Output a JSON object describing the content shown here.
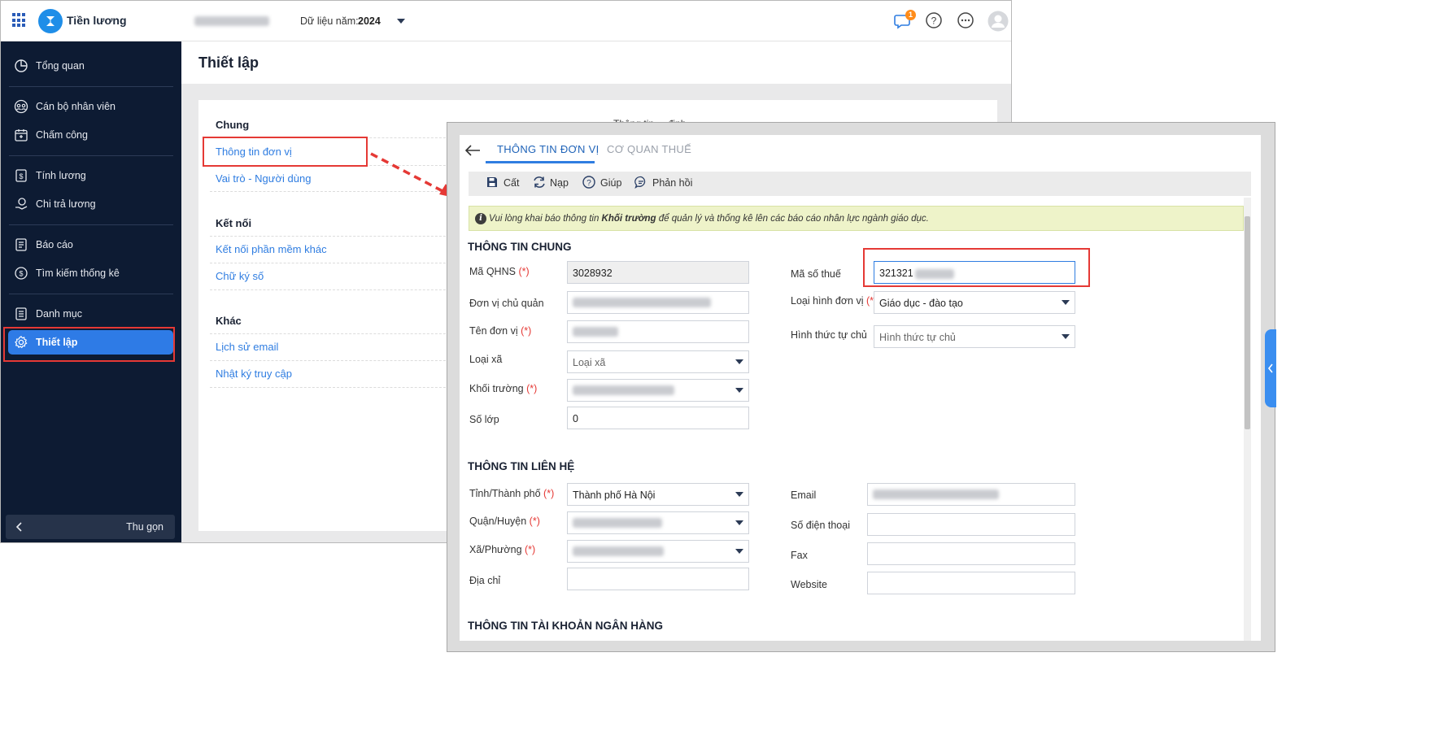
{
  "app": {
    "name": "Tiền lương",
    "org_blurred": "",
    "year_label": "Dữ liệu năm:",
    "year_value": "2024",
    "notification_count": "1"
  },
  "sidebar": {
    "items": [
      {
        "label": "Tổng quan",
        "icon": "pie-chart-icon"
      },
      {
        "label": "Cán bộ nhân viên",
        "icon": "people-icon"
      },
      {
        "label": "Chấm công",
        "icon": "calendar-icon"
      },
      {
        "label": "Tính lương",
        "icon": "money-icon"
      },
      {
        "label": "Chi trả lương",
        "icon": "hand-money-icon"
      },
      {
        "label": "Báo cáo",
        "icon": "report-icon"
      },
      {
        "label": "Tìm kiếm thống kê",
        "icon": "search-stats-icon"
      },
      {
        "label": "Danh mục",
        "icon": "list-icon"
      },
      {
        "label": "Thiết lập",
        "icon": "gear-icon"
      }
    ],
    "active": "Thiết lập",
    "collapse_label": "Thu gọn"
  },
  "page": {
    "title": "Thiết lập",
    "sections": [
      {
        "title": "Chung",
        "links": [
          "Thông tin đơn vị",
          "Vai trò - Người dùng"
        ]
      },
      {
        "title": "Kết nối",
        "links": [
          "Kết nối phần mềm khác",
          "Chữ ký số"
        ]
      },
      {
        "title": "Khác",
        "links": [
          "Lịch sử email",
          "Nhật ký truy cập"
        ]
      }
    ],
    "right_heading_partial": "Thông tin ... định"
  },
  "dialog": {
    "tabs": [
      "THÔNG TIN ĐƠN VỊ",
      "CƠ QUAN THUẾ"
    ],
    "active_tab": "THÔNG TIN ĐƠN VỊ",
    "toolbar": {
      "save": "Cất",
      "reload": "Nạp",
      "help": "Giúp",
      "feedback": "Phản hồi"
    },
    "notice": {
      "before": "Vui lòng khai báo thông tin ",
      "bold": "Khối trường",
      "after": " để quản lý và thống kê lên các báo cáo nhân lực ngành giáo dục."
    },
    "required_mark": "(*)",
    "general": {
      "title": "THÔNG TIN CHUNG",
      "ma_qhns": {
        "label": "Mã QHNS",
        "value": "3028932"
      },
      "don_vi_chu_quan": {
        "label": "Đơn vị chủ quản",
        "value": ""
      },
      "ten_don_vi": {
        "label": "Tên đơn vị",
        "value": ""
      },
      "loai_xa": {
        "label": "Loại xã",
        "placeholder": "Loại xã"
      },
      "khoi_truong": {
        "label": "Khối trường",
        "value": ""
      },
      "so_lop": {
        "label": "Số lớp",
        "value": "0"
      },
      "ma_so_thue": {
        "label": "Mã số thuế",
        "value": "321321"
      },
      "loai_hinh_don_vi": {
        "label": "Loại hình đơn vị",
        "value": "Giáo dục - đào tạo"
      },
      "hinh_thuc_tu_chu": {
        "label": "Hình thức tự chủ",
        "placeholder": "Hình thức tự chủ"
      }
    },
    "contact": {
      "title": "THÔNG TIN LIÊN HỆ",
      "tinh": {
        "label": "Tỉnh/Thành phố",
        "value": "Thành phố Hà Nội"
      },
      "quan": {
        "label": "Quận/Huyện",
        "value": ""
      },
      "xa": {
        "label": "Xã/Phường",
        "value": ""
      },
      "dia_chi": {
        "label": "Địa chỉ",
        "value": ""
      },
      "email": {
        "label": "Email",
        "value": ""
      },
      "so_dien_thoai": {
        "label": "Số điện thoại",
        "value": ""
      },
      "fax": {
        "label": "Fax",
        "value": ""
      },
      "website": {
        "label": "Website",
        "value": ""
      }
    },
    "bank": {
      "title": "THÔNG TIN TÀI KHOẢN NGÂN HÀNG"
    }
  },
  "colors": {
    "accent": "#2f7de1",
    "sidebar_bg": "#0d1b33",
    "highlight": "#e53935",
    "notice_bg": "#eef3c9"
  }
}
